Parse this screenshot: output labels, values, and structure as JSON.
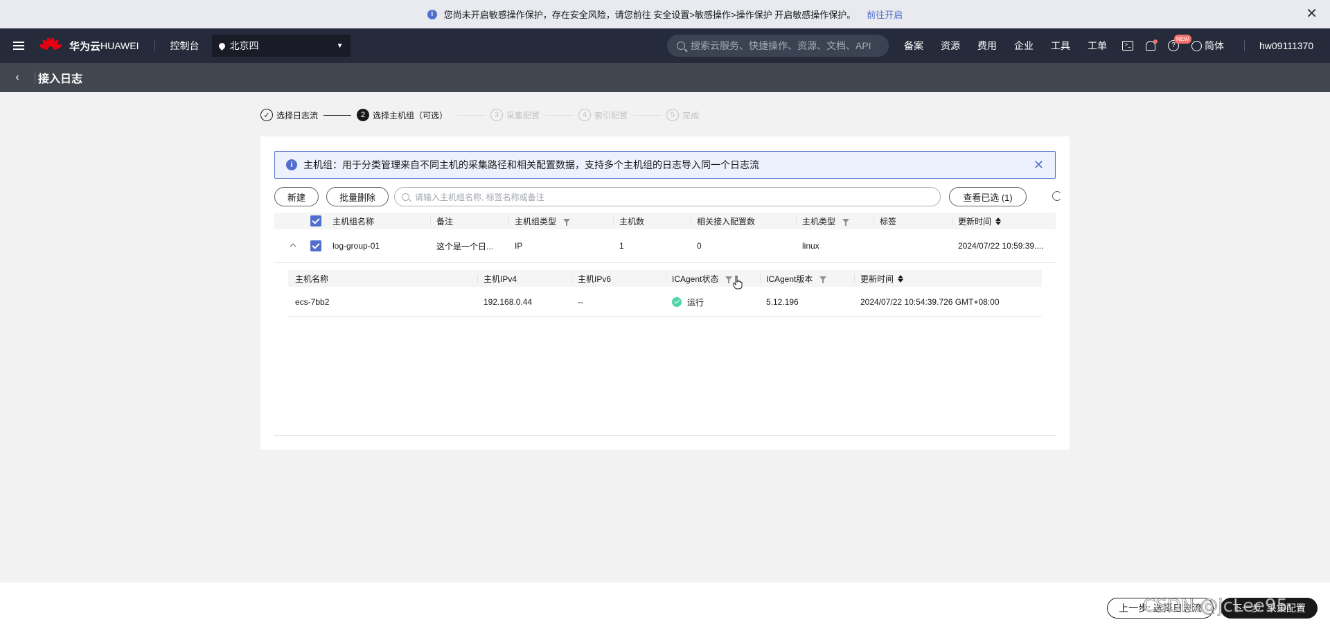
{
  "notice": {
    "text": "您尚未开启敏感操作保护，存在安全风险，请您前往 安全设置>敏感操作>操作保护 开启敏感操作保护。",
    "link": "前往开启"
  },
  "topnav": {
    "brand": "华为云",
    "brand_sub": "HUAWEI",
    "console": "控制台",
    "region": "北京四",
    "search_placeholder": "搜索云服务、快捷操作、资源、文档、API",
    "links": [
      "备案",
      "资源",
      "费用",
      "企业",
      "工具",
      "工单"
    ],
    "new_badge": "NEW",
    "lang": "简体",
    "user": "hw09111370"
  },
  "page": {
    "title": "接入日志"
  },
  "steps": [
    {
      "num": "✓",
      "label": "选择日志流",
      "state": "done"
    },
    {
      "num": "2",
      "label": "选择主机组（可选）",
      "state": "active"
    },
    {
      "num": "3",
      "label": "采集配置",
      "state": "todo"
    },
    {
      "num": "4",
      "label": "索引配置",
      "state": "todo"
    },
    {
      "num": "5",
      "label": "完成",
      "state": "todo"
    }
  ],
  "alert": {
    "text": "主机组：用于分类管理来自不同主机的采集路径和相关配置数据，支持多个主机组的日志导入同一个日志流"
  },
  "toolbar": {
    "new_label": "新建",
    "batch_delete_label": "批量删除",
    "search_placeholder": "请输入主机组名称, 标签名称或备注",
    "view_selected_label": "查看已选 (1)"
  },
  "table": {
    "headers": [
      "主机组名称",
      "备注",
      "主机组类型",
      "主机数",
      "相关接入配置数",
      "主机类型",
      "标签",
      "更新时间"
    ],
    "rows": [
      {
        "name": "log-group-01",
        "remark": "这个是一个日...",
        "type": "IP",
        "host_count": "1",
        "config_count": "0",
        "host_type": "linux",
        "tag": "",
        "updated": "2024/07/22 10:59:39...."
      }
    ]
  },
  "subtable": {
    "headers": [
      "主机名称",
      "主机IPv4",
      "主机IPv6",
      "ICAgent状态",
      "ICAgent版本",
      "更新时间"
    ],
    "rows": [
      {
        "name": "ecs-7bb2",
        "ipv4": "192.168.0.44",
        "ipv6": "--",
        "status": "运行",
        "version": "5.12.196",
        "updated": "2024/07/22 10:54:39.726 GMT+08:00"
      }
    ]
  },
  "footer": {
    "prev_label": "上一步: 选择日志流",
    "next_label": "下一步: 采集配置"
  },
  "watermark": "CSDN @jcLee95",
  "colors": {
    "accent": "#526ecc",
    "topnav_bg": "#252b3a",
    "page_header_bg": "#41464f",
    "status_ok": "#50d4ab"
  }
}
